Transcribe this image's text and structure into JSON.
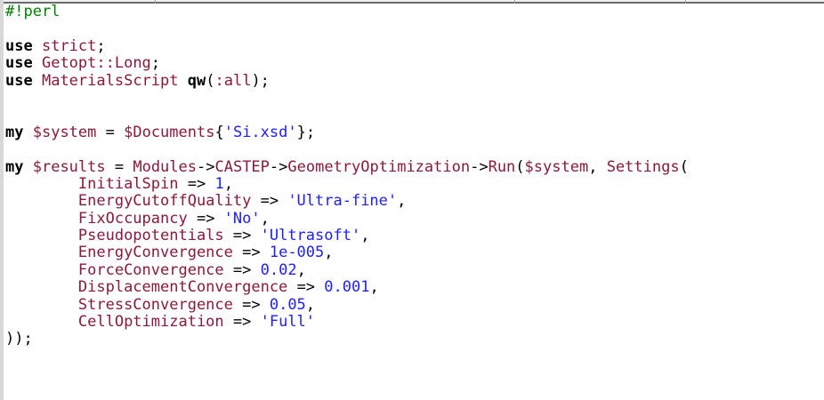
{
  "editor": {
    "lines": [
      [
        {
          "t": "cm",
          "v": "#!perl"
        }
      ],
      [],
      [
        {
          "t": "kw",
          "v": "use"
        },
        {
          "t": "punc",
          "v": " "
        },
        {
          "t": "id",
          "v": "strict"
        },
        {
          "t": "punc",
          "v": ";"
        }
      ],
      [
        {
          "t": "kw",
          "v": "use"
        },
        {
          "t": "punc",
          "v": " "
        },
        {
          "t": "id",
          "v": "Getopt::Long"
        },
        {
          "t": "punc",
          "v": ";"
        }
      ],
      [
        {
          "t": "kw",
          "v": "use"
        },
        {
          "t": "punc",
          "v": " "
        },
        {
          "t": "id",
          "v": "MaterialsScript"
        },
        {
          "t": "punc",
          "v": " "
        },
        {
          "t": "kw",
          "v": "qw"
        },
        {
          "t": "punc",
          "v": "("
        },
        {
          "t": "id",
          "v": ":all"
        },
        {
          "t": "punc",
          "v": ");"
        }
      ],
      [],
      [],
      [
        {
          "t": "kw",
          "v": "my"
        },
        {
          "t": "punc",
          "v": " "
        },
        {
          "t": "var",
          "v": "$system"
        },
        {
          "t": "punc",
          "v": " = "
        },
        {
          "t": "var",
          "v": "$Documents"
        },
        {
          "t": "punc",
          "v": "{"
        },
        {
          "t": "str",
          "v": "'Si.xsd'"
        },
        {
          "t": "punc",
          "v": "};"
        }
      ],
      [],
      [
        {
          "t": "kw",
          "v": "my"
        },
        {
          "t": "punc",
          "v": " "
        },
        {
          "t": "var",
          "v": "$results"
        },
        {
          "t": "punc",
          "v": " = "
        },
        {
          "t": "id",
          "v": "Modules"
        },
        {
          "t": "punc",
          "v": "->"
        },
        {
          "t": "id",
          "v": "CASTEP"
        },
        {
          "t": "punc",
          "v": "->"
        },
        {
          "t": "id",
          "v": "GeometryOptimization"
        },
        {
          "t": "punc",
          "v": "->"
        },
        {
          "t": "id",
          "v": "Run"
        },
        {
          "t": "punc",
          "v": "("
        },
        {
          "t": "var",
          "v": "$system"
        },
        {
          "t": "punc",
          "v": ", "
        },
        {
          "t": "id",
          "v": "Settings"
        },
        {
          "t": "punc",
          "v": "("
        }
      ],
      [
        {
          "t": "punc",
          "v": "        "
        },
        {
          "t": "id",
          "v": "InitialSpin"
        },
        {
          "t": "punc",
          "v": " => "
        },
        {
          "t": "num",
          "v": "1"
        },
        {
          "t": "punc",
          "v": ","
        }
      ],
      [
        {
          "t": "punc",
          "v": "        "
        },
        {
          "t": "id",
          "v": "EnergyCutoffQuality"
        },
        {
          "t": "punc",
          "v": " => "
        },
        {
          "t": "str",
          "v": "'Ultra-fine'"
        },
        {
          "t": "punc",
          "v": ","
        }
      ],
      [
        {
          "t": "punc",
          "v": "        "
        },
        {
          "t": "id",
          "v": "FixOccupancy"
        },
        {
          "t": "punc",
          "v": " => "
        },
        {
          "t": "str",
          "v": "'No'"
        },
        {
          "t": "punc",
          "v": ","
        }
      ],
      [
        {
          "t": "punc",
          "v": "        "
        },
        {
          "t": "id",
          "v": "Pseudopotentials"
        },
        {
          "t": "punc",
          "v": " => "
        },
        {
          "t": "str",
          "v": "'Ultrasoft'"
        },
        {
          "t": "punc",
          "v": ","
        }
      ],
      [
        {
          "t": "punc",
          "v": "        "
        },
        {
          "t": "id",
          "v": "EnergyConvergence"
        },
        {
          "t": "punc",
          "v": " => "
        },
        {
          "t": "num",
          "v": "1e-005"
        },
        {
          "t": "punc",
          "v": ","
        }
      ],
      [
        {
          "t": "punc",
          "v": "        "
        },
        {
          "t": "id",
          "v": "ForceConvergence"
        },
        {
          "t": "punc",
          "v": " => "
        },
        {
          "t": "num",
          "v": "0.02"
        },
        {
          "t": "punc",
          "v": ","
        }
      ],
      [
        {
          "t": "punc",
          "v": "        "
        },
        {
          "t": "id",
          "v": "DisplacementConvergence"
        },
        {
          "t": "punc",
          "v": " => "
        },
        {
          "t": "num",
          "v": "0.001"
        },
        {
          "t": "punc",
          "v": ","
        }
      ],
      [
        {
          "t": "punc",
          "v": "        "
        },
        {
          "t": "id",
          "v": "StressConvergence"
        },
        {
          "t": "punc",
          "v": " => "
        },
        {
          "t": "num",
          "v": "0.05"
        },
        {
          "t": "punc",
          "v": ","
        }
      ],
      [
        {
          "t": "punc",
          "v": "        "
        },
        {
          "t": "id",
          "v": "CellOptimization"
        },
        {
          "t": "punc",
          "v": " => "
        },
        {
          "t": "str",
          "v": "'Full'"
        }
      ],
      [
        {
          "t": "punc",
          "v": "));"
        }
      ]
    ]
  },
  "colors": {
    "comment": "#008000",
    "keyword": "#000000",
    "identifier": "#8b1a3a",
    "string": "#2020ff",
    "number": "#2020ff"
  }
}
